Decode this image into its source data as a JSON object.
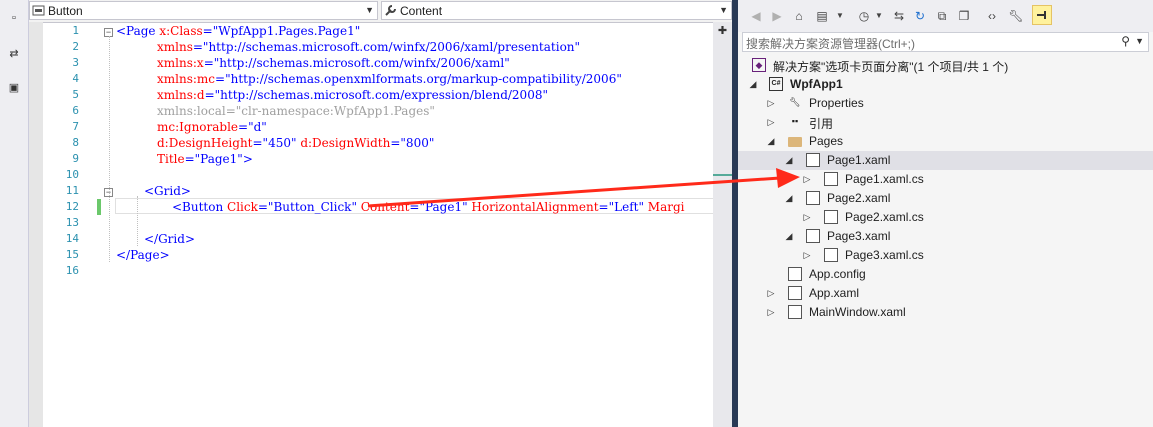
{
  "editor": {
    "nav_left": "Button",
    "nav_right": "Content",
    "line_numbers": [
      "1",
      "2",
      "3",
      "4",
      "5",
      "6",
      "7",
      "8",
      "9",
      "10",
      "11",
      "12",
      "13",
      "14",
      "15",
      "16"
    ],
    "code": {
      "l1_tag": "<Page ",
      "l1_attr": "x:Class",
      "l1_val": "=\"WpfApp1.Pages.Page1\"",
      "l2_attr": "xmlns",
      "l2_val": "=\"http://schemas.microsoft.com/winfx/2006/xaml/presentation\"",
      "l3_attr": "xmlns:x",
      "l3_val": "=\"http://schemas.microsoft.com/winfx/2006/xaml\"",
      "l4_attr": "xmlns:mc",
      "l4_val": "=\"http://schemas.openxmlformats.org/markup-compatibility/2006\"",
      "l5_attr": "xmlns:d",
      "l5_val": "=\"http://schemas.microsoft.com/expression/blend/2008\"",
      "l6_text": "xmlns:local=\"clr-namespace:WpfApp1.Pages\"",
      "l7_attr": "mc:Ignorable",
      "l7_val": "=\"d\"",
      "l8_attr1": "d:DesignHeight",
      "l8_val1": "=\"450\" ",
      "l8_attr2": "d:DesignWidth",
      "l8_val2": "=\"800\"",
      "l9_attr": "Title",
      "l9_val": "=\"Page1\"",
      "l9_close": ">",
      "l11_tag": "<Grid>",
      "l12_tag": "<Button ",
      "l12_attr1": "Click",
      "l12_val1": "=\"Button_Click\" ",
      "l12_attr2": "Content",
      "l12_val2": "=\"Page1\" ",
      "l12_attr3": "HorizontalAlignment",
      "l12_val3": "=\"Left\" ",
      "l12_attr4": "Margi",
      "l14_tag": "</Grid>",
      "l15_tag": "</Page>"
    }
  },
  "solution_explorer": {
    "search_placeholder": "搜索解决方案资源管理器(Ctrl+;)",
    "toolbar_icons": [
      "back-icon",
      "forward-icon",
      "home-icon",
      "switch-views-icon",
      "history-icon",
      "sync-icon",
      "refresh-icon",
      "collapse-all-icon",
      "copy-icon",
      "code-view-icon",
      "properties-icon",
      "pin-icon"
    ],
    "tree": {
      "solution": "解决方案\"选项卡页面分离\"(1 个项目/共 1 个)",
      "project": "WpfApp1",
      "properties": "Properties",
      "references": "引用",
      "pages_folder": "Pages",
      "page1": "Page1.xaml",
      "page1_cs": "Page1.xaml.cs",
      "page2": "Page2.xaml",
      "page2_cs": "Page2.xaml.cs",
      "page3": "Page3.xaml",
      "page3_cs": "Page3.xaml.cs",
      "app_config": "App.config",
      "app_xaml": "App.xaml",
      "main_window": "MainWindow.xaml"
    }
  },
  "colors": {
    "annotation_arrow": "#ff2a1a",
    "editor_bg": "#ffffff",
    "divider": "#293955"
  }
}
